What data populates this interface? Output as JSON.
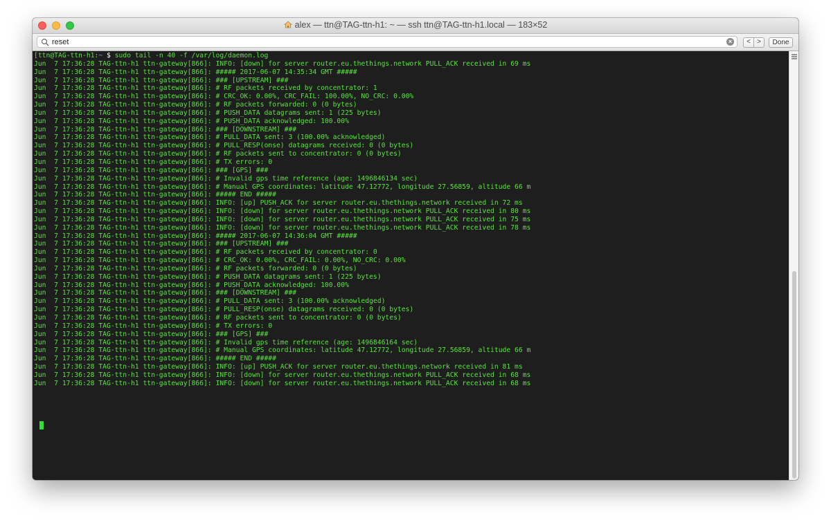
{
  "window": {
    "title": "alex — ttn@TAG-ttn-h1: ~ — ssh ttn@TAG-ttn-h1.local — 183×52"
  },
  "findbar": {
    "search_value": "reset",
    "prev_label": "<",
    "next_label": ">",
    "done_label": "Done"
  },
  "terminal": {
    "prompt_user": "[ttn@TAG-ttn-h1",
    "prompt_sep": ":",
    "prompt_path": "~",
    "prompt_dollar": " $",
    "command": " sudo tail -n 40 -f /var/log/daemon.log",
    "lines": [
      "Jun  7 17:36:28 TAG-ttn-h1 ttn-gateway[866]: INFO: [down] for server router.eu.thethings.network PULL_ACK received in 69 ms",
      "Jun  7 17:36:28 TAG-ttn-h1 ttn-gateway[866]: ##### 2017-06-07 14:35:34 GMT #####",
      "Jun  7 17:36:28 TAG-ttn-h1 ttn-gateway[866]: ### [UPSTREAM] ###",
      "Jun  7 17:36:28 TAG-ttn-h1 ttn-gateway[866]: # RF packets received by concentrator: 1",
      "Jun  7 17:36:28 TAG-ttn-h1 ttn-gateway[866]: # CRC_OK: 0.00%, CRC_FAIL: 100.00%, NO_CRC: 0.00%",
      "Jun  7 17:36:28 TAG-ttn-h1 ttn-gateway[866]: # RF packets forwarded: 0 (0 bytes)",
      "Jun  7 17:36:28 TAG-ttn-h1 ttn-gateway[866]: # PUSH_DATA datagrams sent: 1 (225 bytes)",
      "Jun  7 17:36:28 TAG-ttn-h1 ttn-gateway[866]: # PUSH_DATA acknowledged: 100.00%",
      "Jun  7 17:36:28 TAG-ttn-h1 ttn-gateway[866]: ### [DOWNSTREAM] ###",
      "Jun  7 17:36:28 TAG-ttn-h1 ttn-gateway[866]: # PULL_DATA sent: 3 (100.00% acknowledged)",
      "Jun  7 17:36:28 TAG-ttn-h1 ttn-gateway[866]: # PULL_RESP(onse) datagrams received: 0 (0 bytes)",
      "Jun  7 17:36:28 TAG-ttn-h1 ttn-gateway[866]: # RF packets sent to concentrator: 0 (0 bytes)",
      "Jun  7 17:36:28 TAG-ttn-h1 ttn-gateway[866]: # TX errors: 0",
      "Jun  7 17:36:28 TAG-ttn-h1 ttn-gateway[866]: ### [GPS] ###",
      "Jun  7 17:36:28 TAG-ttn-h1 ttn-gateway[866]: # Invalid gps time reference (age: 1496846134 sec)",
      "Jun  7 17:36:28 TAG-ttn-h1 ttn-gateway[866]: # Manual GPS coordinates: latitude 47.12772, longitude 27.56859, altitude 66 m",
      "Jun  7 17:36:28 TAG-ttn-h1 ttn-gateway[866]: ##### END #####",
      "Jun  7 17:36:28 TAG-ttn-h1 ttn-gateway[866]: INFO: [up] PUSH_ACK for server router.eu.thethings.network received in 72 ms",
      "Jun  7 17:36:28 TAG-ttn-h1 ttn-gateway[866]: INFO: [down] for server router.eu.thethings.network PULL_ACK received in 80 ms",
      "Jun  7 17:36:28 TAG-ttn-h1 ttn-gateway[866]: INFO: [down] for server router.eu.thethings.network PULL_ACK received in 75 ms",
      "Jun  7 17:36:28 TAG-ttn-h1 ttn-gateway[866]: INFO: [down] for server router.eu.thethings.network PULL_ACK received in 78 ms",
      "Jun  7 17:36:28 TAG-ttn-h1 ttn-gateway[866]: ##### 2017-06-07 14:36:04 GMT #####",
      "Jun  7 17:36:28 TAG-ttn-h1 ttn-gateway[866]: ### [UPSTREAM] ###",
      "Jun  7 17:36:28 TAG-ttn-h1 ttn-gateway[866]: # RF packets received by concentrator: 0",
      "Jun  7 17:36:28 TAG-ttn-h1 ttn-gateway[866]: # CRC_OK: 0.00%, CRC_FAIL: 0.00%, NO_CRC: 0.00%",
      "Jun  7 17:36:28 TAG-ttn-h1 ttn-gateway[866]: # RF packets forwarded: 0 (0 bytes)",
      "Jun  7 17:36:28 TAG-ttn-h1 ttn-gateway[866]: # PUSH_DATA datagrams sent: 1 (225 bytes)",
      "Jun  7 17:36:28 TAG-ttn-h1 ttn-gateway[866]: # PUSH_DATA acknowledged: 100.00%",
      "Jun  7 17:36:28 TAG-ttn-h1 ttn-gateway[866]: ### [DOWNSTREAM] ###",
      "Jun  7 17:36:28 TAG-ttn-h1 ttn-gateway[866]: # PULL_DATA sent: 3 (100.00% acknowledged)",
      "Jun  7 17:36:28 TAG-ttn-h1 ttn-gateway[866]: # PULL_RESP(onse) datagrams received: 0 (0 bytes)",
      "Jun  7 17:36:28 TAG-ttn-h1 ttn-gateway[866]: # RF packets sent to concentrator: 0 (0 bytes)",
      "Jun  7 17:36:28 TAG-ttn-h1 ttn-gateway[866]: # TX errors: 0",
      "Jun  7 17:36:28 TAG-ttn-h1 ttn-gateway[866]: ### [GPS] ###",
      "Jun  7 17:36:28 TAG-ttn-h1 ttn-gateway[866]: # Invalid gps time reference (age: 1496846164 sec)",
      "Jun  7 17:36:28 TAG-ttn-h1 ttn-gateway[866]: # Manual GPS coordinates: latitude 47.12772, longitude 27.56859, altitude 66 m",
      "Jun  7 17:36:28 TAG-ttn-h1 ttn-gateway[866]: ##### END #####",
      "Jun  7 17:36:28 TAG-ttn-h1 ttn-gateway[866]: INFO: [up] PUSH_ACK for server router.eu.thethings.network received in 81 ms",
      "Jun  7 17:36:28 TAG-ttn-h1 ttn-gateway[866]: INFO: [down] for server router.eu.thethings.network PULL_ACK received in 68 ms",
      "Jun  7 17:36:28 TAG-ttn-h1 ttn-gateway[866]: INFO: [down] for server router.eu.thethings.network PULL_ACK received in 68 ms"
    ]
  },
  "colors": {
    "terminal_bg": "#1e1e1e",
    "terminal_text": "#58e63a",
    "prompt_path": "#6aa7ff",
    "cursor": "#2fe02f"
  }
}
